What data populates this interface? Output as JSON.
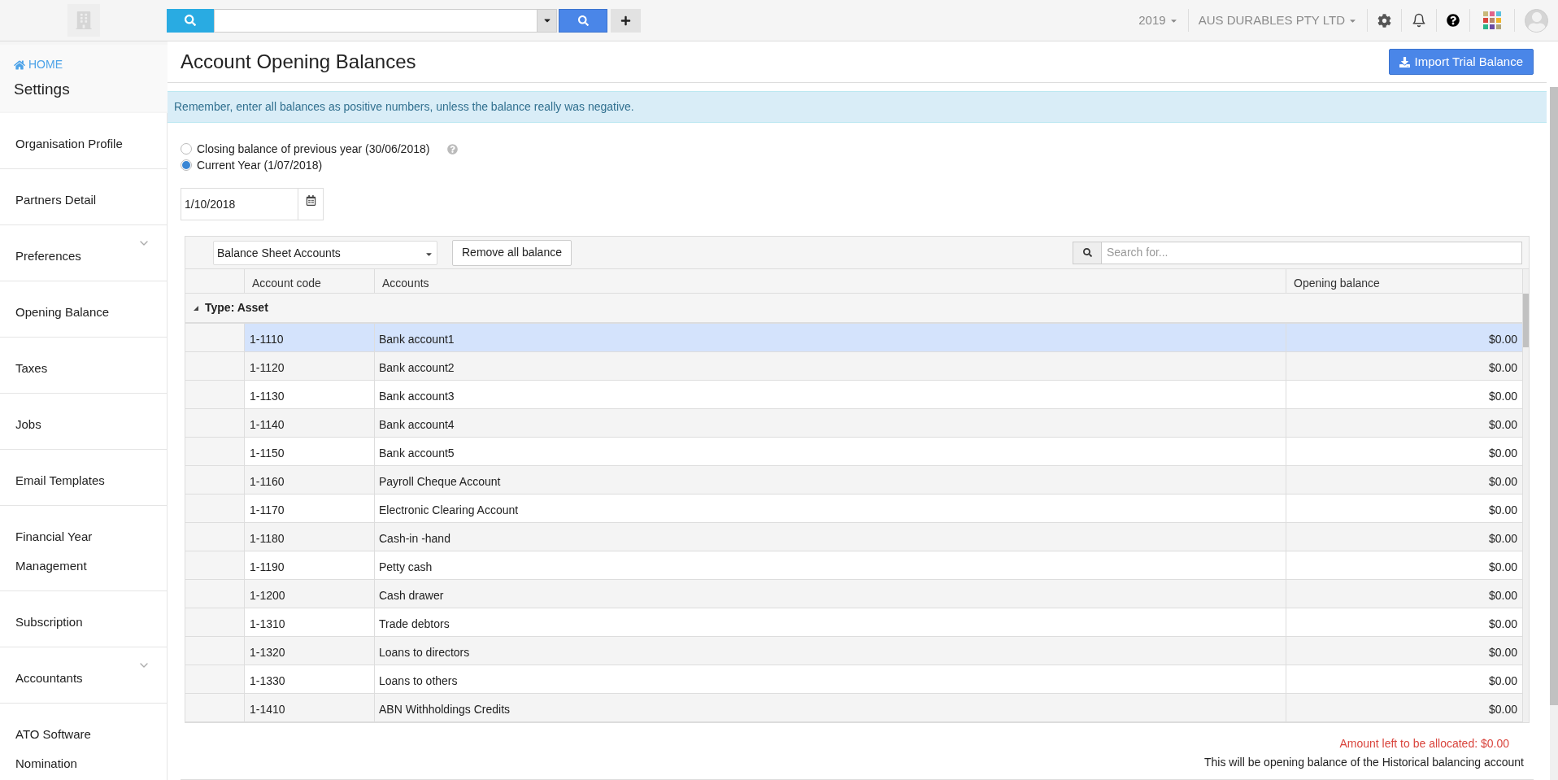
{
  "topbar": {
    "year": "2019",
    "company": "AUS DURABLES PTY LTD"
  },
  "sidebar": {
    "home": "HOME",
    "title": "Settings",
    "items": [
      {
        "label": "Organisation Profile",
        "expandable": false
      },
      {
        "label": "Partners Detail",
        "expandable": false
      },
      {
        "label": "Preferences",
        "expandable": true
      },
      {
        "label": "Opening Balance",
        "expandable": false
      },
      {
        "label": "Taxes",
        "expandable": false
      },
      {
        "label": "Jobs",
        "expandable": false
      },
      {
        "label": "Email Templates",
        "expandable": false
      },
      {
        "label": "Financial Year Management",
        "expandable": false
      },
      {
        "label": "Subscription",
        "expandable": false
      },
      {
        "label": "Accountants",
        "expandable": true
      },
      {
        "label": "ATO Software Nomination",
        "expandable": false
      }
    ]
  },
  "page": {
    "title": "Account Opening Balances",
    "import_button": "Import Trial Balance",
    "notice": "Remember, enter all balances as positive numbers, unless the balance really was negative.",
    "options": [
      {
        "label": "Closing balance of previous year (30/06/2018)",
        "selected": false
      },
      {
        "label": "Current Year (1/07/2018)",
        "selected": true
      }
    ],
    "date": "1/10/2018"
  },
  "table": {
    "filter": "Balance Sheet Accounts",
    "remove_button": "Remove all balance",
    "search": {
      "placeholder": "Search for..."
    },
    "columns": [
      "Account code",
      "Accounts",
      "Opening balance"
    ],
    "group": "Type: Asset",
    "rows": [
      {
        "code": "1-1110",
        "account": "Bank account1",
        "balance": "$0.00",
        "selected": true
      },
      {
        "code": "1-1120",
        "account": "Bank account2",
        "balance": "$0.00",
        "selected": false
      },
      {
        "code": "1-1130",
        "account": "Bank account3",
        "balance": "$0.00",
        "selected": false
      },
      {
        "code": "1-1140",
        "account": "Bank account4",
        "balance": "$0.00",
        "selected": false
      },
      {
        "code": "1-1150",
        "account": "Bank account5",
        "balance": "$0.00",
        "selected": false
      },
      {
        "code": "1-1160",
        "account": "Payroll Cheque Account",
        "balance": "$0.00",
        "selected": false
      },
      {
        "code": "1-1170",
        "account": "Electronic Clearing Account",
        "balance": "$0.00",
        "selected": false
      },
      {
        "code": "1-1180",
        "account": "Cash-in -hand",
        "balance": "$0.00",
        "selected": false
      },
      {
        "code": "1-1190",
        "account": "Petty cash",
        "balance": "$0.00",
        "selected": false
      },
      {
        "code": "1-1200",
        "account": "Cash drawer",
        "balance": "$0.00",
        "selected": false
      },
      {
        "code": "1-1310",
        "account": "Trade debtors",
        "balance": "$0.00",
        "selected": false
      },
      {
        "code": "1-1320",
        "account": "Loans to directors",
        "balance": "$0.00",
        "selected": false
      },
      {
        "code": "1-1330",
        "account": "Loans to others",
        "balance": "$0.00",
        "selected": false
      },
      {
        "code": "1-1410",
        "account": "ABN Withholdings Credits",
        "balance": "$0.00",
        "selected": false
      }
    ]
  },
  "footer": {
    "amount_left": "Amount left to be allocated: $0.00",
    "note": "This will be opening balance of the Historical balancing account"
  }
}
